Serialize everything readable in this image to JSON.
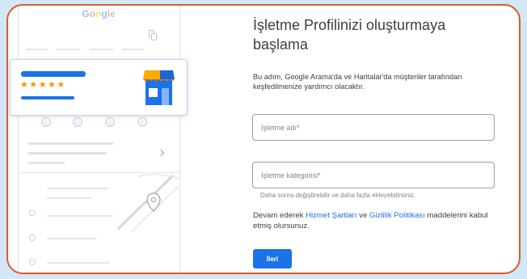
{
  "colors": {
    "background": "#d2e8f6",
    "frame_border": "#e4572e",
    "accent": "#1a73e8",
    "star": "#f29900",
    "title_text": "#3c4043",
    "body_text": "#3c4043",
    "placeholder_text": "#80868b",
    "link": "#1a73e8",
    "button_text": "#ffffff"
  },
  "illustration": {
    "logo_letters": [
      "G",
      "o",
      "o",
      "g",
      "l",
      "e"
    ],
    "logo_colors": [
      "#8ab4f8",
      "#f6a39d",
      "#fcd76b",
      "#8ab4f8",
      "#8fd1a4",
      "#f6a39d"
    ],
    "rating": {
      "value": 5,
      "max": 5
    },
    "icons": {
      "star": "star-icon",
      "store": "store-icon",
      "copy": "copy-icon",
      "chevron": "chevron-right-icon",
      "map_pin": "map-pin-icon"
    }
  },
  "form": {
    "title": "İşletme Profilinizi oluşturmaya başlama",
    "description": "Bu adım, Google Arama'da ve Haritalar'da müşteriler tarafından keşfedilmenize yardımcı olacaktır.",
    "business_name": {
      "placeholder": "İşletme adı*",
      "value": ""
    },
    "business_category": {
      "placeholder": "İşletme kategorisi*",
      "value": "",
      "helper": "Daha sonra değiştirebilir ve daha fazla ekleyebilirsiniz."
    },
    "terms": {
      "prefix": "Devam ederek",
      "terms_link": "Hizmet Şartları",
      "conjunction": "ve",
      "privacy_link": "Gizlilik Politikası",
      "suffix": "maddelerini kabul etmiş olursunuz."
    },
    "next_button": "İleri"
  }
}
